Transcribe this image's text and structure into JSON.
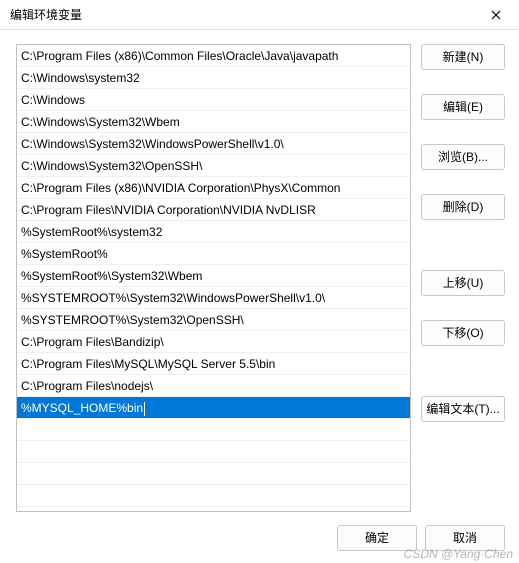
{
  "titlebar": {
    "title": "编辑环境变量"
  },
  "paths": [
    "C:\\Program Files (x86)\\Common Files\\Oracle\\Java\\javapath",
    "C:\\Windows\\system32",
    "C:\\Windows",
    "C:\\Windows\\System32\\Wbem",
    "C:\\Windows\\System32\\WindowsPowerShell\\v1.0\\",
    "C:\\Windows\\System32\\OpenSSH\\",
    "C:\\Program Files (x86)\\NVIDIA Corporation\\PhysX\\Common",
    "C:\\Program Files\\NVIDIA Corporation\\NVIDIA NvDLISR",
    "%SystemRoot%\\system32",
    "%SystemRoot%",
    "%SystemRoot%\\System32\\Wbem",
    "%SYSTEMROOT%\\System32\\WindowsPowerShell\\v1.0\\",
    "%SYSTEMROOT%\\System32\\OpenSSH\\",
    "C:\\Program Files\\Bandizip\\",
    "C:\\Program Files\\MySQL\\MySQL Server 5.5\\bin",
    "C:\\Program Files\\nodejs\\",
    "%MYSQL_HOME%bin"
  ],
  "selected_index": 16,
  "buttons": {
    "new": "新建(N)",
    "edit": "编辑(E)",
    "browse": "浏览(B)...",
    "delete": "删除(D)",
    "moveup": "上移(U)",
    "movedown": "下移(O)",
    "edittext": "编辑文本(T)...",
    "ok": "确定",
    "cancel": "取消"
  },
  "watermark": "CSDN @Yang·Chen"
}
